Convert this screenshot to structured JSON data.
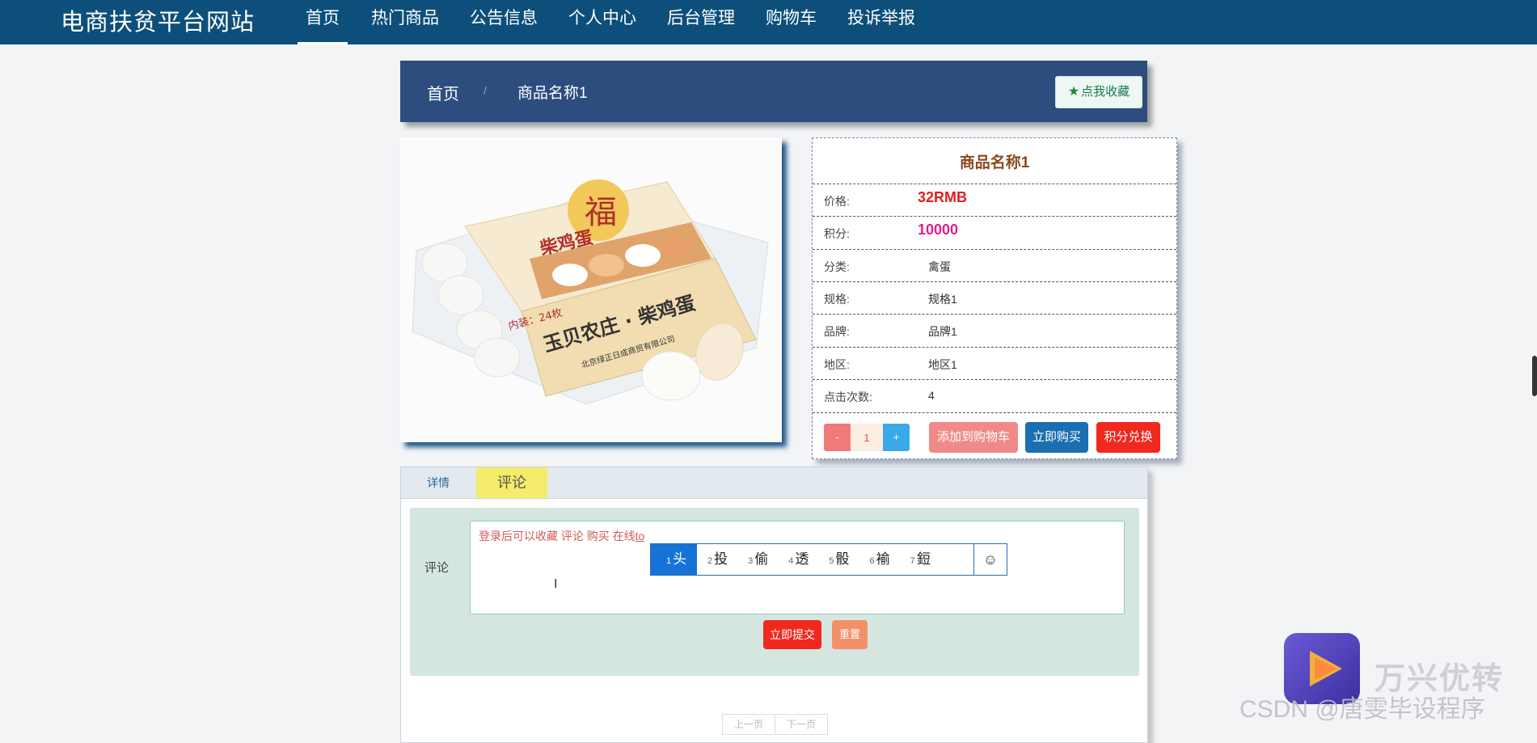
{
  "brand": "电商扶贫平台网站",
  "nav": [
    "首页",
    "热门商品",
    "公告信息",
    "个人中心",
    "后台管理",
    "购物车",
    "投诉举报"
  ],
  "breadcrumb": {
    "home": "首页",
    "sep": "/",
    "current": "商品名称1"
  },
  "fav_button": "点我收藏",
  "product": {
    "title": "商品名称1",
    "rows": [
      {
        "label": "价格:",
        "value": "32RMB"
      },
      {
        "label": "积分:",
        "value": "10000"
      },
      {
        "label": "分类:",
        "value": "禽蛋"
      },
      {
        "label": "规格:",
        "value": "规格1"
      },
      {
        "label": "品牌:",
        "value": "品牌1"
      },
      {
        "label": "地区:",
        "value": "地区1"
      },
      {
        "label": "点击次数:",
        "value": "4"
      }
    ],
    "qty": {
      "minus": "-",
      "value": "1",
      "plus": "+"
    },
    "actions": {
      "cart": "添加到购物车",
      "buy": "立即购买",
      "exchange": "积分兑换"
    },
    "image_text": {
      "line1": "玉贝农庄 · 柴鸡蛋",
      "line2": "北京绿正日成商贸有限公司",
      "small": "柴鸡蛋",
      "count": "内装：24枚",
      "fu": "福"
    }
  },
  "tabs": {
    "detail": "详情",
    "comment": "评论"
  },
  "comment": {
    "label": "评论",
    "text": "登录后可以收藏 评论  购买  在线",
    "typing": "to",
    "cursor": "I",
    "submit": "立即提交",
    "reset": "重置"
  },
  "ime": {
    "candidates": [
      {
        "n": "1",
        "c": "头"
      },
      {
        "n": "2",
        "c": "投"
      },
      {
        "n": "3",
        "c": "偷"
      },
      {
        "n": "4",
        "c": "透"
      },
      {
        "n": "5",
        "c": "骰"
      },
      {
        "n": "6",
        "c": "褕"
      },
      {
        "n": "7",
        "c": "鋀"
      }
    ],
    "emoji": "☺"
  },
  "pager": {
    "prev": "上一页",
    "next": "下一页"
  },
  "watermark": {
    "app": "万兴优转",
    "csdn": "CSDN @唐雯毕设程序"
  }
}
